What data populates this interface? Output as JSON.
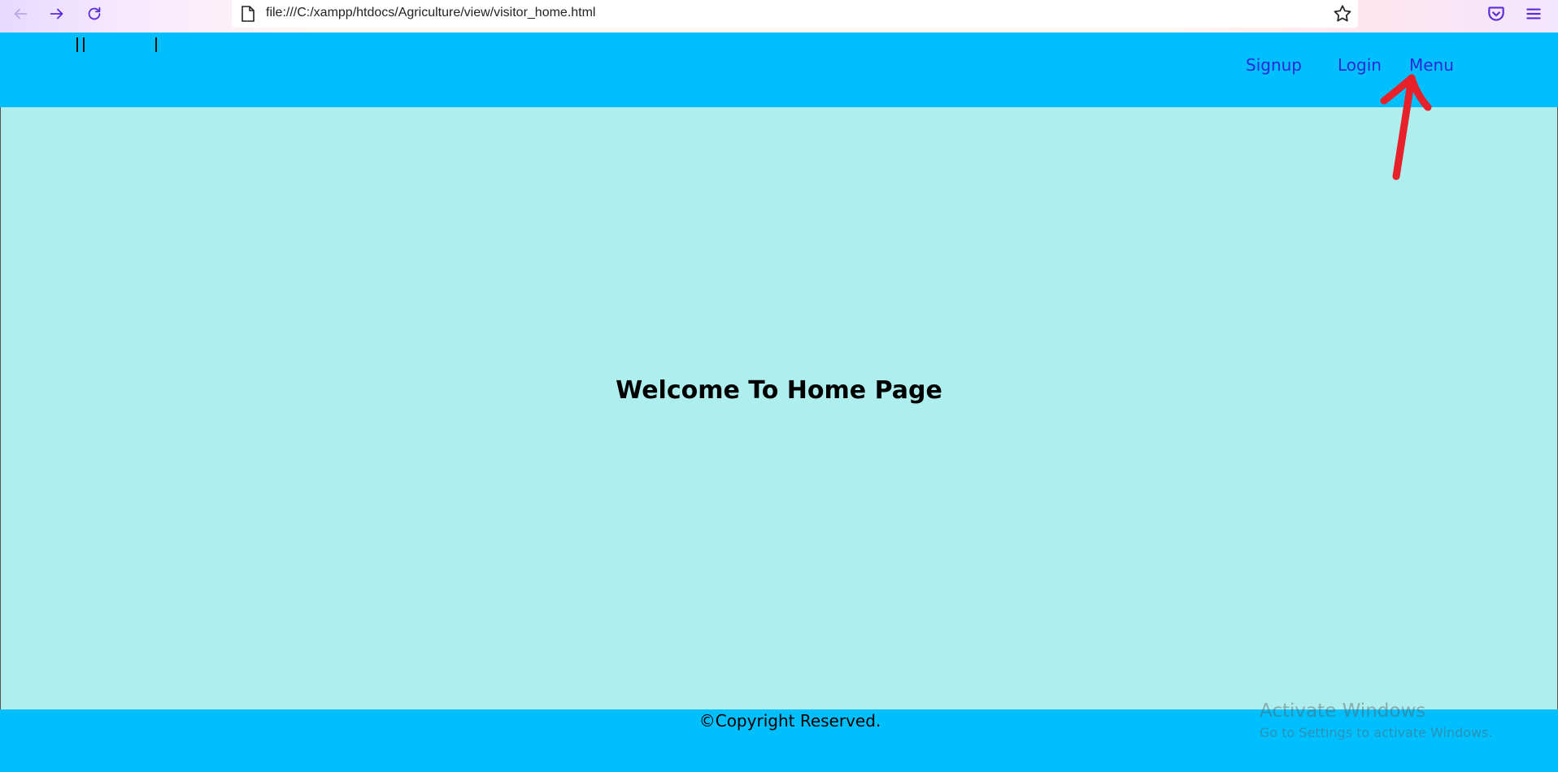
{
  "browser": {
    "url": "file:///C:/xampp/htdocs/Agriculture/view/visitor_home.html",
    "icons": {
      "back": "back-arrow-icon",
      "forward": "forward-arrow-icon",
      "reload": "reload-icon",
      "page": "page-icon",
      "bookmark": "star-icon",
      "pocket": "pocket-icon",
      "menu": "hamburger-menu-icon"
    },
    "accent_color": "#5b2bd6"
  },
  "header": {
    "background_color": "#00bfff",
    "nav": {
      "signup": "Signup",
      "login": "Login",
      "menu": "Menu"
    },
    "link_color": "#2a2ad6"
  },
  "main": {
    "background_color": "#afeeee",
    "heading": "Welcome To Home Page"
  },
  "footer": {
    "background_color": "#00bfff",
    "text": "©Copyright Reserved."
  },
  "watermark": {
    "title": "Activate Windows",
    "subtitle": "Go to Settings to activate Windows."
  },
  "annotation": {
    "type": "red-arrow",
    "color": "#e8202a"
  }
}
